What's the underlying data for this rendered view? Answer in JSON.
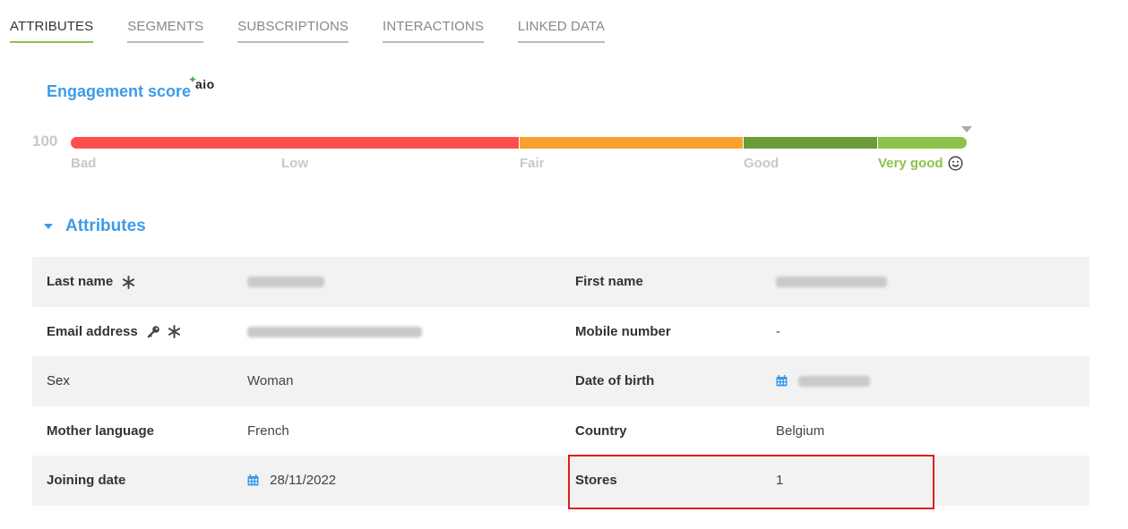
{
  "tabs": [
    {
      "label": "ATTRIBUTES",
      "active": true
    },
    {
      "label": "SEGMENTS",
      "active": false
    },
    {
      "label": "SUBSCRIPTIONS",
      "active": false
    },
    {
      "label": "INTERACTIONS",
      "active": false
    },
    {
      "label": "LINKED DATA",
      "active": false
    }
  ],
  "engagement": {
    "title": "Engagement score",
    "badge": "aio",
    "score": "100",
    "labels": {
      "bad": "Bad",
      "low": "Low",
      "fair": "Fair",
      "good": "Good",
      "very_good": "Very good"
    },
    "colors": {
      "bad": "#ff4d4d",
      "fair": "#f9a12d",
      "good": "#6a9c3a",
      "very_good": "#8bc34a"
    }
  },
  "attributes": {
    "title": "Attributes",
    "rows": [
      {
        "left_label": "Last name",
        "left_value": "",
        "right_label": "First name",
        "right_value": ""
      },
      {
        "left_label": "Email address",
        "left_value": "",
        "right_label": "Mobile number",
        "right_value": "-"
      },
      {
        "left_label": "Sex",
        "left_value": "Woman",
        "right_label": "Date of birth",
        "right_value": ""
      },
      {
        "left_label": "Mother language",
        "left_value": "French",
        "right_label": "Country",
        "right_value": "Belgium"
      },
      {
        "left_label": "Joining date",
        "left_value": "28/11/2022",
        "right_label": "Stores",
        "right_value": "1"
      }
    ]
  },
  "icons": {
    "required": "asterisk-icon",
    "key": "key-icon",
    "calendar": "calendar-icon",
    "smile": "smile-icon",
    "toggle": "caret-down-icon"
  },
  "accent_color": "#3d9be9",
  "highlight_color": "#e01e1e"
}
